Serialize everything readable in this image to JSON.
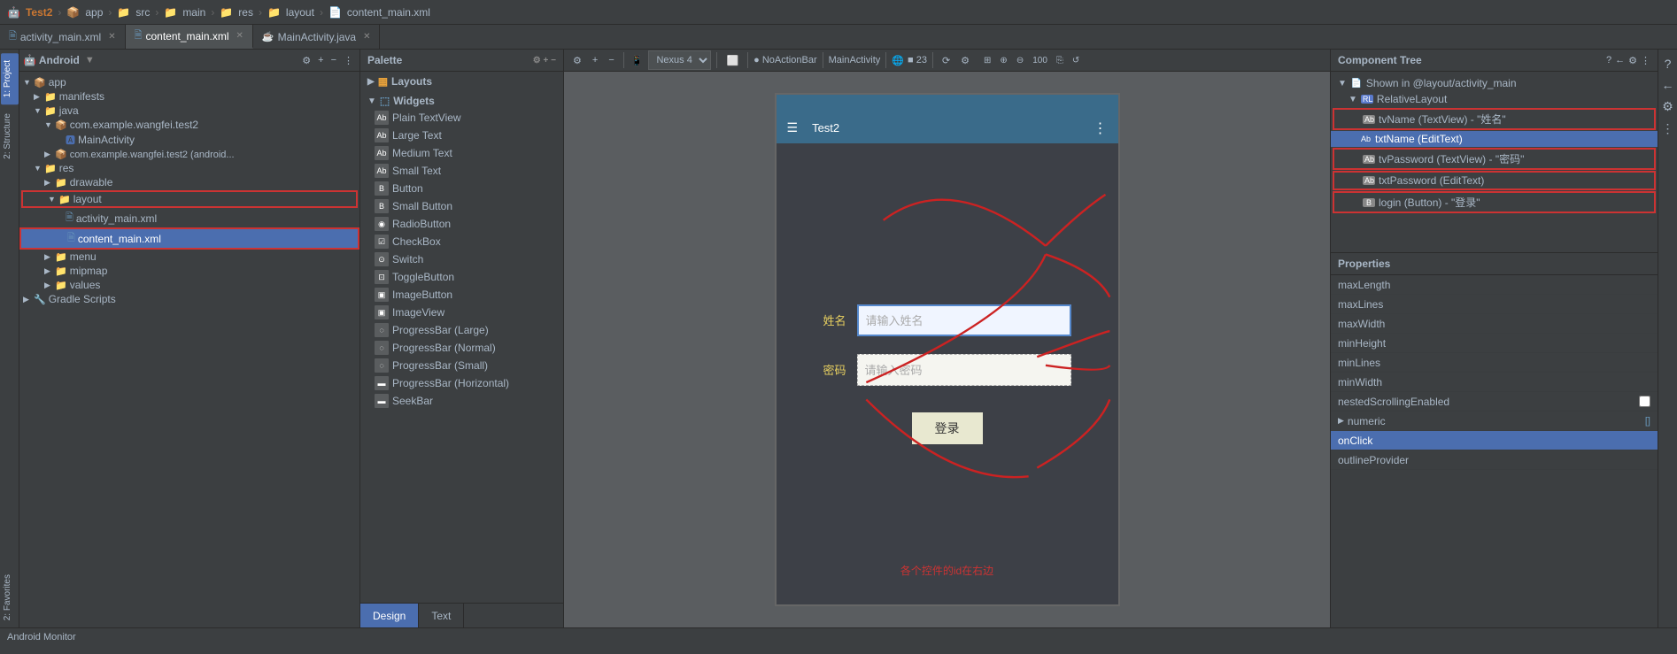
{
  "topbar": {
    "project": "Test2",
    "app": "app",
    "src": "src",
    "main": "main",
    "res": "res",
    "layout": "layout",
    "file": "content_main.xml"
  },
  "tabs": [
    {
      "label": "activity_main.xml",
      "active": false,
      "icon": "xml"
    },
    {
      "label": "content_main.xml",
      "active": true,
      "icon": "xml"
    },
    {
      "label": "MainActivity.java",
      "active": false,
      "icon": "java"
    }
  ],
  "toolbar": {
    "android_label": "Android",
    "nexus": "Nexus 4",
    "theme": "NoActionBar",
    "activity": "MainActivity",
    "api": "23"
  },
  "palette": {
    "title": "Palette",
    "sections": [
      {
        "name": "Layouts",
        "items": []
      },
      {
        "name": "Widgets",
        "items": [
          {
            "label": "Plain TextView",
            "icon": "Ab"
          },
          {
            "label": "Large Text",
            "icon": "Ab"
          },
          {
            "label": "Medium Text",
            "icon": "Ab"
          },
          {
            "label": "Small Text",
            "icon": "Ab"
          },
          {
            "label": "Button",
            "icon": "B"
          },
          {
            "label": "Small Button",
            "icon": "B"
          },
          {
            "label": "RadioButton",
            "icon": "◉"
          },
          {
            "label": "CheckBox",
            "icon": "☑"
          },
          {
            "label": "Switch",
            "icon": "⊙"
          },
          {
            "label": "ToggleButton",
            "icon": "⊡"
          },
          {
            "label": "ImageButton",
            "icon": "▣"
          },
          {
            "label": "ImageView",
            "icon": "▣"
          },
          {
            "label": "ProgressBar (Large)",
            "icon": "◌"
          },
          {
            "label": "ProgressBar (Normal)",
            "icon": "◌"
          },
          {
            "label": "ProgressBar (Small)",
            "icon": "◌"
          },
          {
            "label": "ProgressBar (Horizontal)",
            "icon": "▬"
          },
          {
            "label": "SeekBar",
            "icon": "▬"
          }
        ]
      }
    ]
  },
  "component_tree": {
    "title": "Component Tree",
    "items": [
      {
        "label": "Shown in @layout/activity_main",
        "indent": 0,
        "icon": "📄",
        "type": "info"
      },
      {
        "label": "RelativeLayout",
        "indent": 1,
        "icon": "RL",
        "type": "layout"
      },
      {
        "label": "tvName (TextView) - \"姓名\"",
        "indent": 2,
        "icon": "Ab",
        "type": "textview",
        "highlighted": true
      },
      {
        "label": "txtName (EditText)",
        "indent": 2,
        "icon": "Ab",
        "type": "edittext",
        "selected": true
      },
      {
        "label": "tvPassword (TextView) - \"密码\"",
        "indent": 2,
        "icon": "Ab",
        "type": "textview",
        "highlighted": true
      },
      {
        "label": "txtPassword (EditText)",
        "indent": 2,
        "icon": "Ab",
        "type": "edittext",
        "highlighted": true
      },
      {
        "label": "login (Button) - \"登录\"",
        "indent": 2,
        "icon": "B",
        "type": "button",
        "highlighted": true
      }
    ]
  },
  "properties": {
    "title": "Properties",
    "items": [
      {
        "label": "maxLength",
        "value": ""
      },
      {
        "label": "maxLines",
        "value": ""
      },
      {
        "label": "maxWidth",
        "value": ""
      },
      {
        "label": "minHeight",
        "value": ""
      },
      {
        "label": "minLines",
        "value": ""
      },
      {
        "label": "minWidth",
        "value": ""
      },
      {
        "label": "nestedScrollingEnabled",
        "value": ""
      },
      {
        "label": "numeric",
        "value": "[]",
        "expandable": true
      },
      {
        "label": "onClick",
        "value": "",
        "selected": true
      },
      {
        "label": "outlineProvider",
        "value": ""
      }
    ]
  },
  "project_tree": {
    "items": [
      {
        "label": "app",
        "indent": 0,
        "type": "module",
        "expanded": true
      },
      {
        "label": "manifests",
        "indent": 1,
        "type": "folder",
        "expanded": false
      },
      {
        "label": "java",
        "indent": 1,
        "type": "folder",
        "expanded": true
      },
      {
        "label": "com.example.wangfei.test2",
        "indent": 2,
        "type": "package",
        "expanded": true
      },
      {
        "label": "MainActivity",
        "indent": 3,
        "type": "java"
      },
      {
        "label": "com.example.wangfei.test2 (android...)",
        "indent": 2,
        "type": "package",
        "expanded": false
      },
      {
        "label": "res",
        "indent": 1,
        "type": "folder",
        "expanded": true
      },
      {
        "label": "drawable",
        "indent": 2,
        "type": "folder",
        "expanded": false
      },
      {
        "label": "layout",
        "indent": 2,
        "type": "folder",
        "expanded": true,
        "highlighted": true
      },
      {
        "label": "activity_main.xml",
        "indent": 3,
        "type": "xml"
      },
      {
        "label": "content_main.xml",
        "indent": 3,
        "type": "xml",
        "selected": true
      },
      {
        "label": "menu",
        "indent": 2,
        "type": "folder",
        "expanded": false
      },
      {
        "label": "mipmap",
        "indent": 2,
        "type": "folder",
        "expanded": false
      },
      {
        "label": "values",
        "indent": 2,
        "type": "folder",
        "expanded": false
      },
      {
        "label": "Gradle Scripts",
        "indent": 0,
        "type": "folder",
        "expanded": false
      }
    ]
  },
  "preview": {
    "name_label": "姓名",
    "name_hint": "请输入姓名",
    "password_label": "密码",
    "password_hint": "请输入密码",
    "login_btn": "登录",
    "hint_text": "各个控件的id在右边"
  },
  "design_tabs": [
    {
      "label": "Design",
      "active": true
    },
    {
      "label": "Text",
      "active": false
    }
  ],
  "strip_tabs": [
    {
      "label": "1: Project"
    },
    {
      "label": "2: Structure"
    },
    {
      "label": "2: Favorites"
    }
  ],
  "status_bar": {
    "text": "Android Monitor"
  }
}
